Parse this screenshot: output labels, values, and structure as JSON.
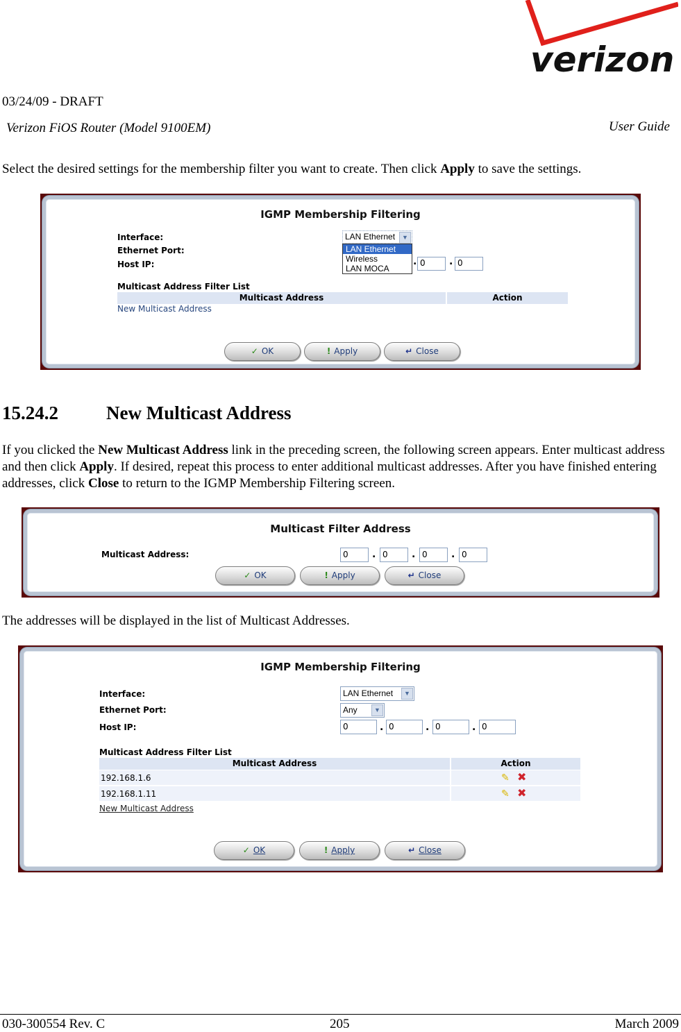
{
  "header": {
    "logo_text": "verizon",
    "draft": "03/24/09 - DRAFT",
    "model": "Verizon FiOS Router (Model 9100EM)",
    "guide": "User Guide"
  },
  "intro": {
    "pre": "Select the desired settings for the membership filter you want to create. Then click ",
    "bold": "Apply",
    "post": " to save the settings."
  },
  "screen1": {
    "title": "IGMP Membership Filtering",
    "labels": {
      "interface": "Interface:",
      "port": "Ethernet Port:",
      "host": "Host IP:"
    },
    "interface_value": "LAN Ethernet",
    "dropdown_options": [
      "LAN Ethernet",
      "Wireless",
      "LAN MOCA"
    ],
    "dropdown_selected": "LAN Ethernet",
    "host_ip_visible": [
      "0",
      "0"
    ],
    "list_title": "Multicast Address Filter List",
    "col_address": "Multicast Address",
    "col_action": "Action",
    "new_link": "New Multicast Address",
    "buttons": {
      "ok": "OK",
      "apply": "Apply",
      "close": "Close"
    }
  },
  "section": {
    "number": "15.24.2",
    "title": "New Multicast Address"
  },
  "para2": {
    "t1": "If you clicked the ",
    "b1": "New Multicast Address",
    "t2": " link in the preceding screen, the following screen appears. Enter multicast address and then click ",
    "b2": "Apply",
    "t3": ". If desired, repeat this process to enter additional multicast addresses. After you have finished entering addresses, click ",
    "b3": "Close",
    "t4": " to return to the IGMP Membership Filtering screen."
  },
  "screen2": {
    "title": "Multicast Filter Address",
    "label": "Multicast Address:",
    "octets": [
      "0",
      "0",
      "0",
      "0"
    ],
    "buttons": {
      "ok": "OK",
      "apply": "Apply",
      "close": "Close"
    }
  },
  "para3": "The addresses will be displayed in the list of Multicast Addresses.",
  "screen3": {
    "title": "IGMP Membership Filtering",
    "labels": {
      "interface": "Interface:",
      "port": "Ethernet Port:",
      "host": "Host IP:"
    },
    "interface_value": "LAN Ethernet",
    "port_value": "Any",
    "host_ip": [
      "0",
      "0",
      "0",
      "0"
    ],
    "list_title": "Multicast Address Filter List",
    "col_address": "Multicast Address",
    "col_action": "Action",
    "rows": [
      {
        "address": "192.168.1.6"
      },
      {
        "address": "192.168.1.11"
      }
    ],
    "new_link": "New Multicast Address",
    "buttons": {
      "ok": "OK",
      "apply": "Apply",
      "close": "Close"
    }
  },
  "footer": {
    "doc": "030-300554 Rev. C",
    "page": "205",
    "date": "March 2009"
  },
  "icons": {
    "ok": "✓",
    "apply": "!",
    "close": "↵",
    "edit": "✎",
    "delete": "✖",
    "chevron": "▼"
  }
}
